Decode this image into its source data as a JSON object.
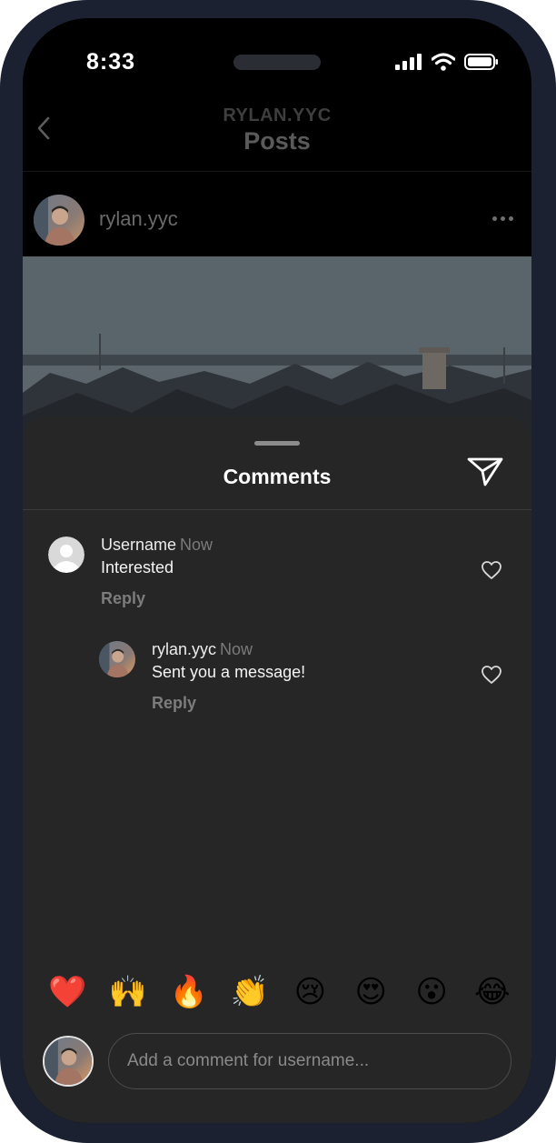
{
  "status_bar": {
    "time": "8:33"
  },
  "header": {
    "account": "RYLAN.YYC",
    "title": "Posts"
  },
  "post": {
    "username": "rylan.yyc"
  },
  "comments_sheet": {
    "title": "Comments",
    "comments": [
      {
        "username": "Username",
        "time": "Now",
        "text": "Interested",
        "reply_label": "Reply"
      },
      {
        "username": "rylan.yyc",
        "time": "Now",
        "text": "Sent you a message!",
        "reply_label": "Reply"
      }
    ],
    "emojis": [
      "❤️",
      "🙌",
      "🔥",
      "👏",
      "😢",
      "😍",
      "😮",
      "😂"
    ],
    "input": {
      "placeholder": "Add a comment for username..."
    }
  },
  "icons": [
    "back-icon",
    "more-icon",
    "send-icon",
    "heart-icon",
    "wifi-icon",
    "signal-icon",
    "battery-icon"
  ],
  "colors": {
    "sheet_bg": "#262626",
    "screen_bg": "#000000",
    "frame": "#1b2130",
    "muted_text": "#7a7a7a"
  }
}
